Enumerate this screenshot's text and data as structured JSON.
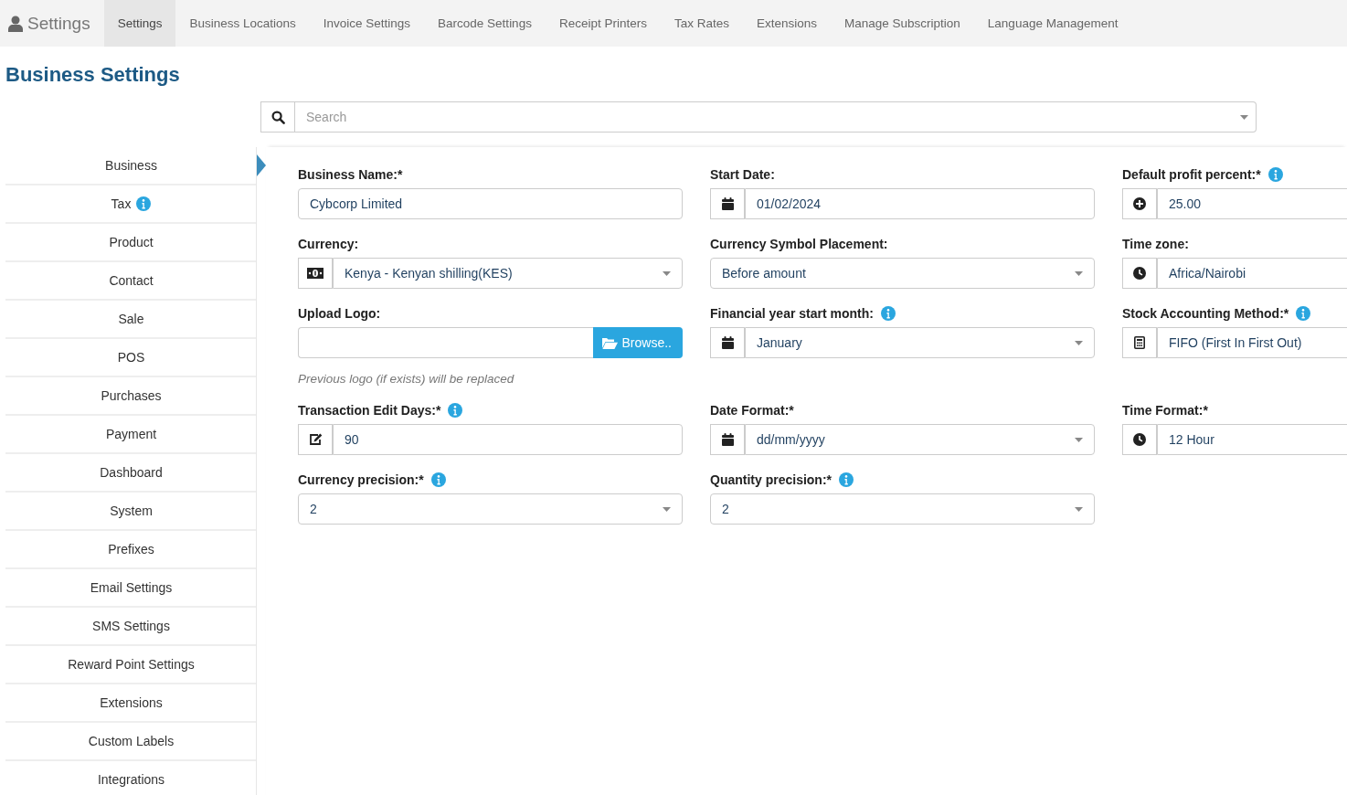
{
  "nav": {
    "brand": "Settings",
    "tabs": [
      {
        "label": "Settings",
        "selected": true
      },
      {
        "label": "Business Locations",
        "selected": false
      },
      {
        "label": "Invoice Settings",
        "selected": false
      },
      {
        "label": "Barcode Settings",
        "selected": false
      },
      {
        "label": "Receipt Printers",
        "selected": false
      },
      {
        "label": "Tax Rates",
        "selected": false
      },
      {
        "label": "Extensions",
        "selected": false
      },
      {
        "label": "Manage Subscription",
        "selected": false
      },
      {
        "label": "Language Management",
        "selected": false
      }
    ]
  },
  "page_title": "Business Settings",
  "search": {
    "placeholder": "Search"
  },
  "sidebar": {
    "items": [
      {
        "label": "Business",
        "selected": true,
        "info": false
      },
      {
        "label": "Tax",
        "selected": false,
        "info": true
      },
      {
        "label": "Product",
        "selected": false,
        "info": false
      },
      {
        "label": "Contact",
        "selected": false,
        "info": false
      },
      {
        "label": "Sale",
        "selected": false,
        "info": false
      },
      {
        "label": "POS",
        "selected": false,
        "info": false
      },
      {
        "label": "Purchases",
        "selected": false,
        "info": false
      },
      {
        "label": "Payment",
        "selected": false,
        "info": false
      },
      {
        "label": "Dashboard",
        "selected": false,
        "info": false
      },
      {
        "label": "System",
        "selected": false,
        "info": false
      },
      {
        "label": "Prefixes",
        "selected": false,
        "info": false
      },
      {
        "label": "Email Settings",
        "selected": false,
        "info": false
      },
      {
        "label": "SMS Settings",
        "selected": false,
        "info": false
      },
      {
        "label": "Reward Point Settings",
        "selected": false,
        "info": false
      },
      {
        "label": "Extensions",
        "selected": false,
        "info": false
      },
      {
        "label": "Custom Labels",
        "selected": false,
        "info": false
      },
      {
        "label": "Integrations",
        "selected": false,
        "info": false
      }
    ]
  },
  "fields": [
    {
      "label": "Business Name:*",
      "kind": "text",
      "value": "Cybcorp Limited",
      "info": false
    },
    {
      "label": "Start Date:",
      "kind": "text",
      "addon": {
        "kind": "calendar"
      },
      "value": "01/02/2024",
      "info": false
    },
    {
      "label": "Default profit percent:*",
      "kind": "text",
      "addon": {
        "kind": "plus"
      },
      "value": "25.00",
      "info": true
    },
    {
      "label": "Currency:",
      "kind": "select",
      "addon": {
        "kind": "money"
      },
      "value": "Kenya - Kenyan shilling(KES)",
      "info": false
    },
    {
      "label": "Currency Symbol Placement:",
      "kind": "select",
      "value": "Before amount",
      "info": false
    },
    {
      "label": "Time zone:",
      "kind": "text",
      "addon": {
        "kind": "clock"
      },
      "value": "Africa/Nairobi",
      "info": false
    },
    {
      "label": "Upload Logo:",
      "kind": "file",
      "button": "Browse..",
      "help": "Previous logo (if exists) will be replaced",
      "info": false
    },
    {
      "label": "Financial year start month:",
      "kind": "select",
      "addon": {
        "kind": "calendar"
      },
      "value": "January",
      "info": true
    },
    {
      "label": "Stock Accounting Method:*",
      "kind": "text",
      "addon": {
        "kind": "calculator"
      },
      "value": "FIFO (First In First Out)",
      "info": true
    },
    {
      "label": "Transaction Edit Days:*",
      "kind": "text",
      "addon": {
        "kind": "edit"
      },
      "value": "90",
      "info": true
    },
    {
      "label": "Date Format:*",
      "kind": "select",
      "addon": {
        "kind": "calendar"
      },
      "value": "dd/mm/yyyy",
      "info": false
    },
    {
      "label": "Time Format:*",
      "kind": "text",
      "addon": {
        "kind": "clock"
      },
      "value": "12 Hour",
      "info": false
    },
    {
      "label": "Currency precision:*",
      "kind": "select",
      "value": "2",
      "info": true
    },
    {
      "label": "Quantity precision:*",
      "kind": "select",
      "value": "2",
      "info": true
    }
  ]
}
